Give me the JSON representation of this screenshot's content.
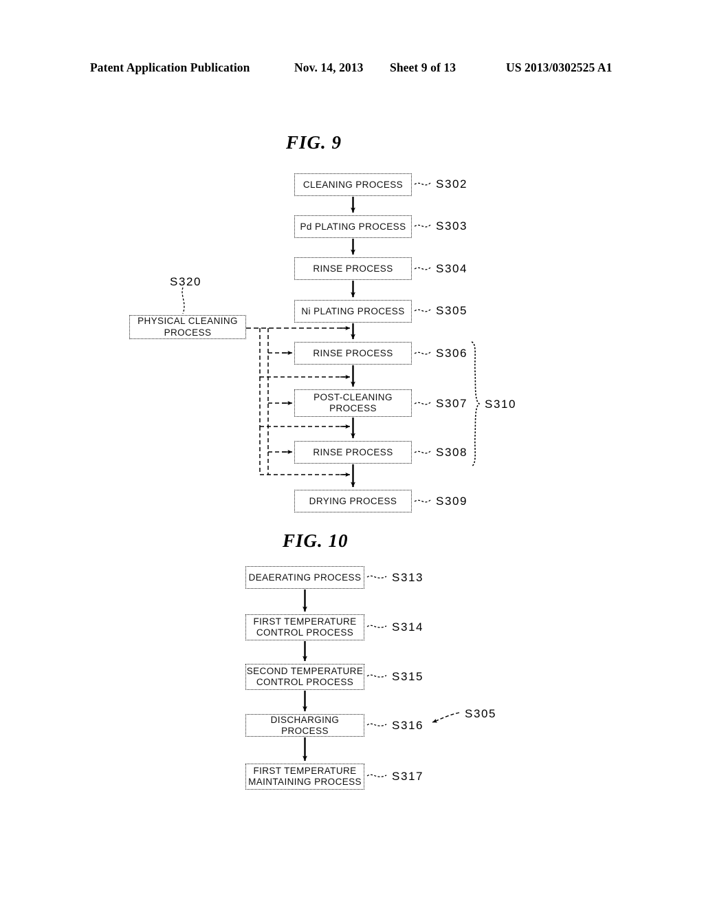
{
  "header": {
    "publication": "Patent Application Publication",
    "date": "Nov. 14, 2013",
    "sheet": "Sheet 9 of 13",
    "number": "US 2013/0302525 A1"
  },
  "figures": [
    {
      "title": "FIG. 9",
      "boxes": [
        {
          "id": "s302",
          "label": "CLEANING PROCESS",
          "ref": "S302"
        },
        {
          "id": "s303",
          "label": "Pd PLATING PROCESS",
          "ref": "S303"
        },
        {
          "id": "s304",
          "label": "RINSE PROCESS",
          "ref": "S304"
        },
        {
          "id": "s305",
          "label": "Ni PLATING PROCESS",
          "ref": "S305"
        },
        {
          "id": "s306",
          "label": "RINSE PROCESS",
          "ref": "S306"
        },
        {
          "id": "s307",
          "label_line1": "POST-CLEANING",
          "label_line2": "PROCESS",
          "ref": "S307"
        },
        {
          "id": "s308",
          "label": "RINSE PROCESS",
          "ref": "S308"
        },
        {
          "id": "s309",
          "label": "DRYING PROCESS",
          "ref": "S309"
        }
      ],
      "side_box": {
        "id": "s320",
        "label_line1": "PHYSICAL CLEANING",
        "label_line2": "PROCESS",
        "ref": "S320"
      },
      "group_brace": {
        "ref": "S310",
        "covers": [
          "S306",
          "S307",
          "S308"
        ]
      }
    },
    {
      "title": "FIG. 10",
      "boxes": [
        {
          "id": "s313",
          "label": "DEAERATING PROCESS",
          "ref": "S313"
        },
        {
          "id": "s314",
          "label_line1": "FIRST TEMPERATURE",
          "label_line2": "CONTROL PROCESS",
          "ref": "S314"
        },
        {
          "id": "s315",
          "label_line1": "SECOND TEMPERATURE",
          "label_line2": "CONTROL PROCESS",
          "ref": "S315"
        },
        {
          "id": "s316",
          "label": "DISCHARGING PROCESS",
          "ref": "S316"
        },
        {
          "id": "s317",
          "label_line1": "FIRST TEMPERATURE",
          "label_line2": "MAINTAINING PROCESS",
          "ref": "S317"
        }
      ],
      "callout": {
        "ref": "S305"
      }
    }
  ],
  "colors": {
    "ink": "#000000",
    "paper": "#ffffff"
  }
}
